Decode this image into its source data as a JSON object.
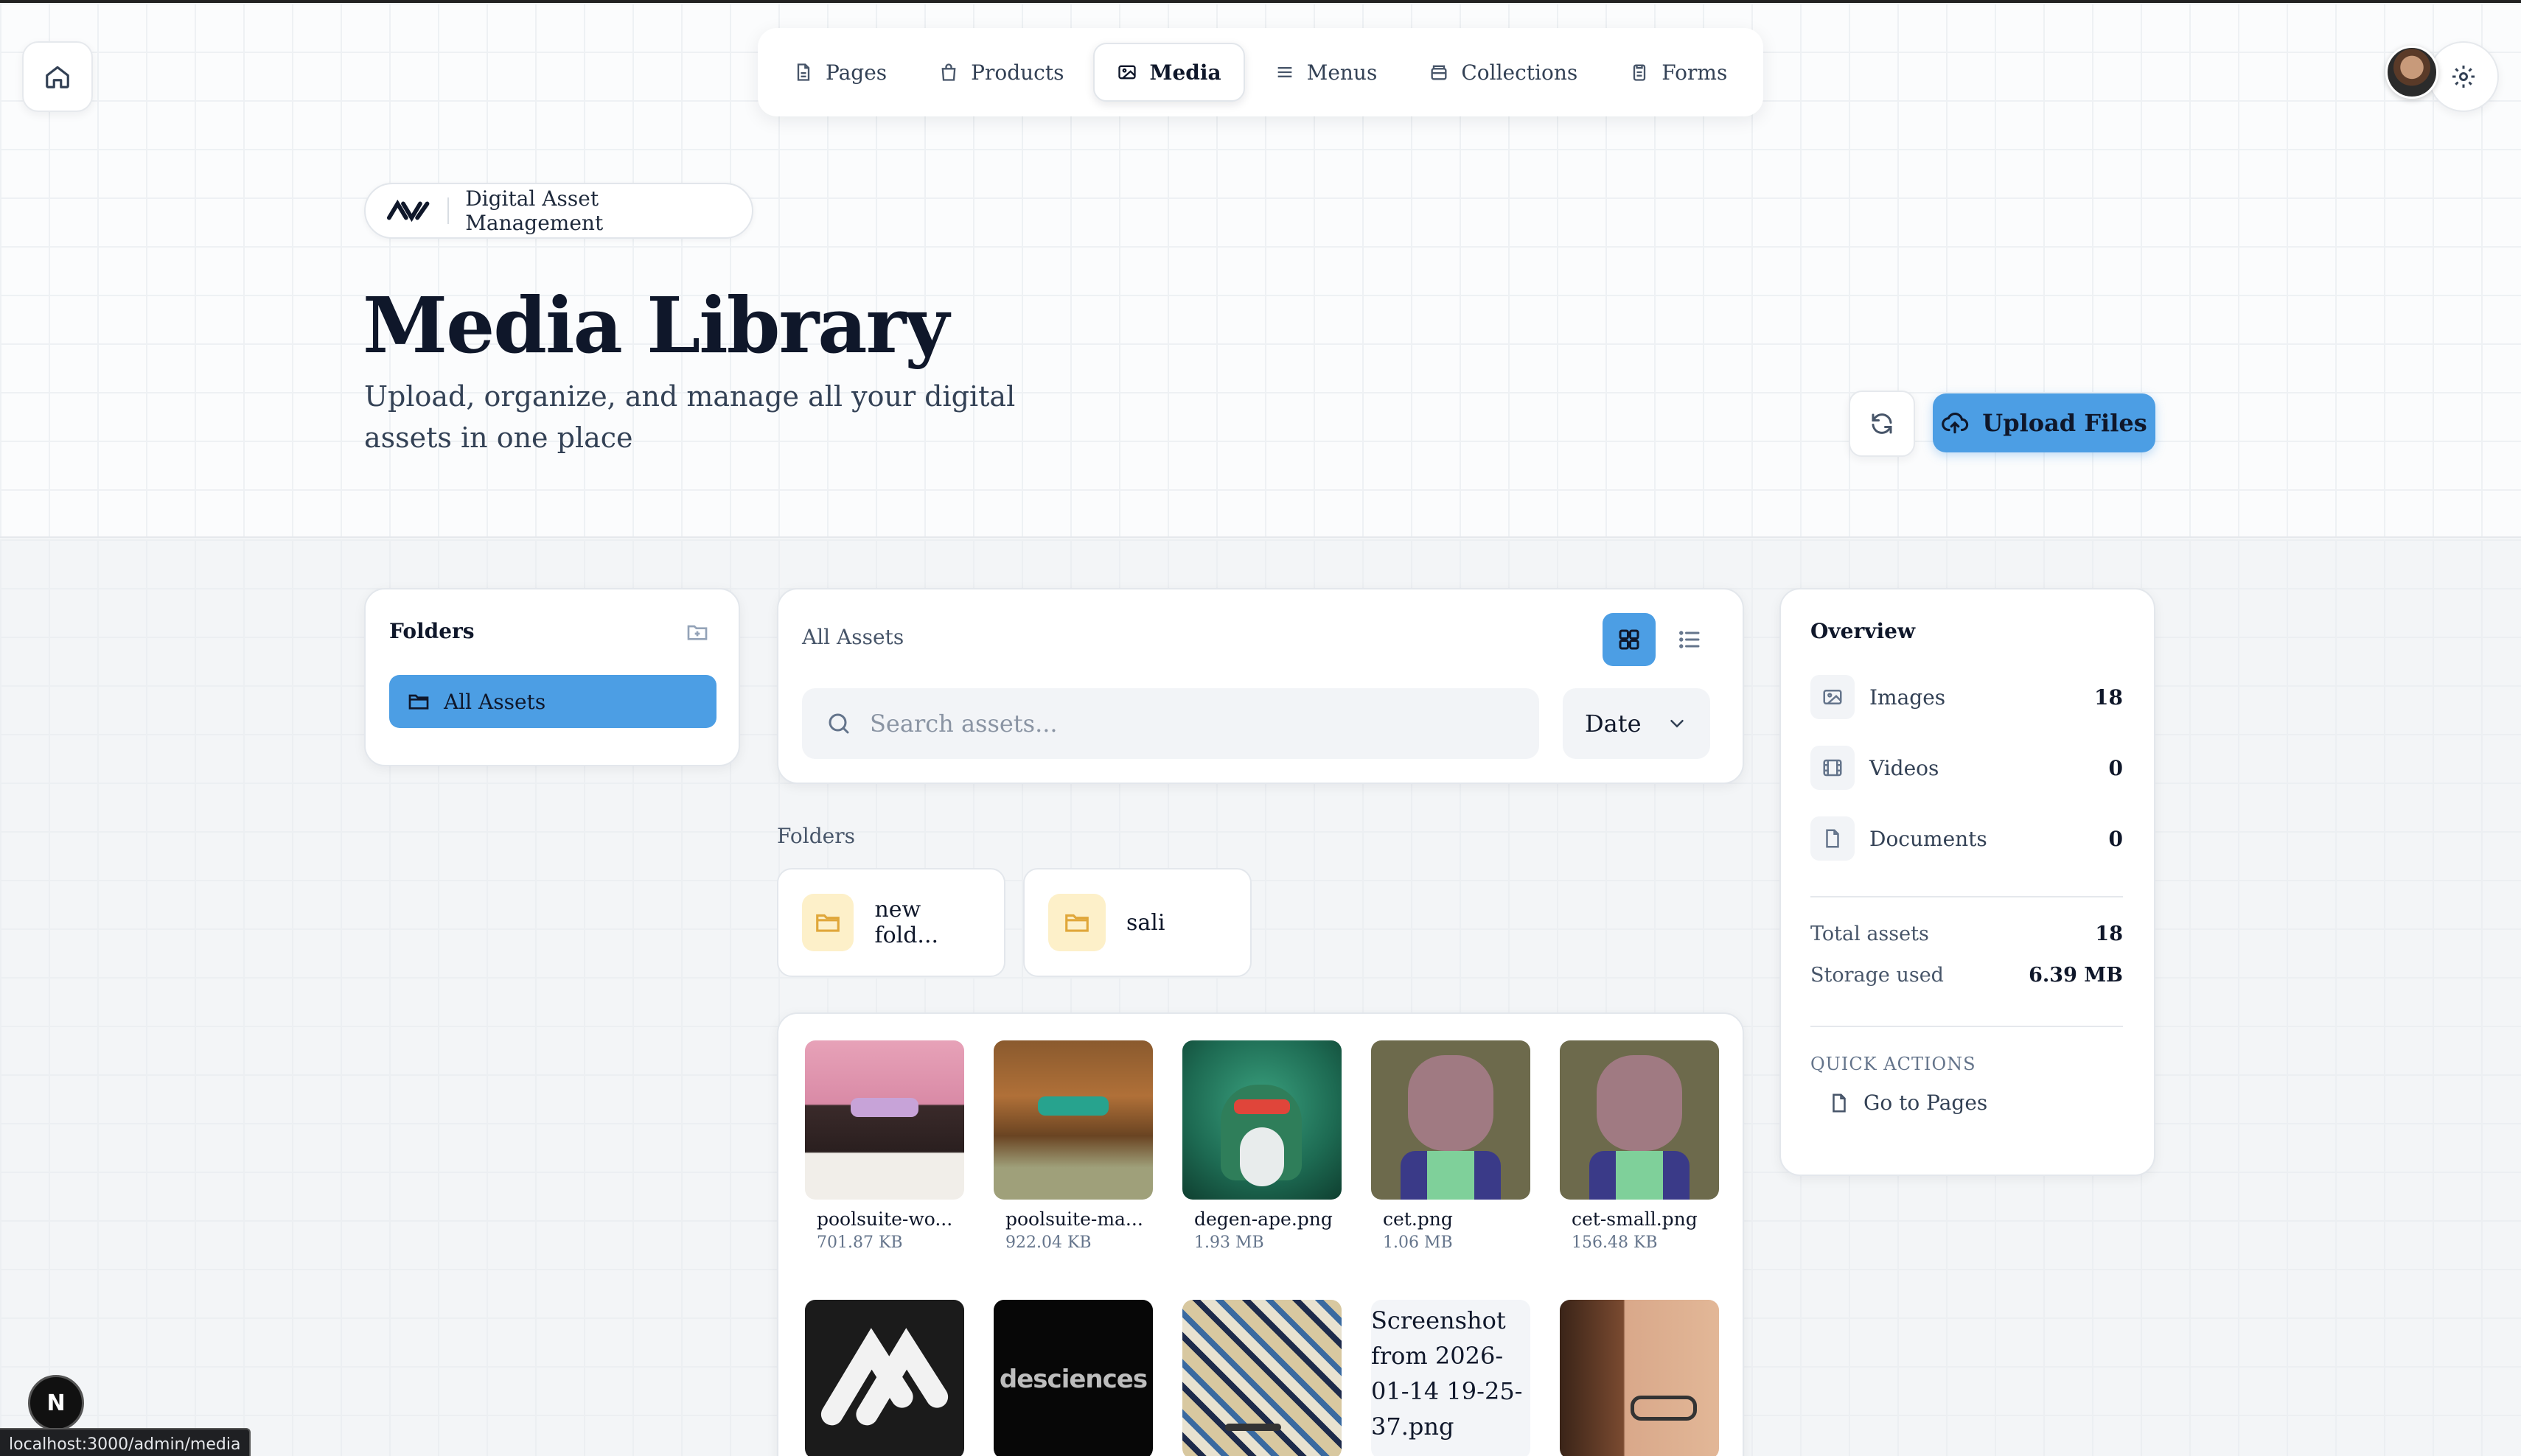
{
  "nav": {
    "items": [
      {
        "label": "Pages",
        "icon": "file-icon",
        "active": false
      },
      {
        "label": "Products",
        "icon": "shopping-bag-icon",
        "active": false
      },
      {
        "label": "Media",
        "icon": "image-icon",
        "active": true
      },
      {
        "label": "Menus",
        "icon": "menu-lines-icon",
        "active": false
      },
      {
        "label": "Collections",
        "icon": "archive-icon",
        "active": false
      },
      {
        "label": "Forms",
        "icon": "clipboard-icon",
        "active": false
      }
    ]
  },
  "header": {
    "badge": "Digital Asset Management",
    "title": "Media Library",
    "subtitle": "Upload, organize, and manage all your digital assets in one place",
    "upload_label": "Upload Files"
  },
  "sidebar": {
    "title": "Folders",
    "active_folder": "All Assets"
  },
  "main": {
    "heading": "All Assets",
    "search_placeholder": "Search assets...",
    "sort_value": "Date",
    "folders_heading": "Folders",
    "folders": [
      {
        "name": "new fold..."
      },
      {
        "name": "sali"
      }
    ],
    "assets": [
      {
        "name": "poolsuite-wo...",
        "size": "701.87 KB"
      },
      {
        "name": "poolsuite-ma...",
        "size": "922.04 KB"
      },
      {
        "name": "degen-ape.png",
        "size": "1.93 MB"
      },
      {
        "name": "cet.png",
        "size": "1.06 MB"
      },
      {
        "name": "cet-small.png",
        "size": "156.48 KB"
      }
    ],
    "assets_row2": [
      {
        "alt": ""
      },
      {
        "alt": "desciences"
      },
      {
        "alt": ""
      },
      {
        "alt": "Screenshot from 2026-01-14 19-25-37.png"
      },
      {
        "alt": ""
      }
    ]
  },
  "overview": {
    "title": "Overview",
    "rows": [
      {
        "label": "Images",
        "value": "18",
        "icon": "image-icon"
      },
      {
        "label": "Videos",
        "value": "0",
        "icon": "film-icon"
      },
      {
        "label": "Documents",
        "value": "0",
        "icon": "document-icon"
      }
    ],
    "total_label": "Total assets",
    "total_value": "18",
    "storage_label": "Storage used",
    "storage_value": "6.39 MB",
    "quick_actions_title": "QUICK ACTIONS",
    "quick_action": "Go to Pages"
  },
  "status_bar": {
    "url": "localhost:3000/admin/media",
    "badge": "N"
  },
  "colors": {
    "accent": "#4c9ee4",
    "folder_chip": "#fdf0c9"
  }
}
